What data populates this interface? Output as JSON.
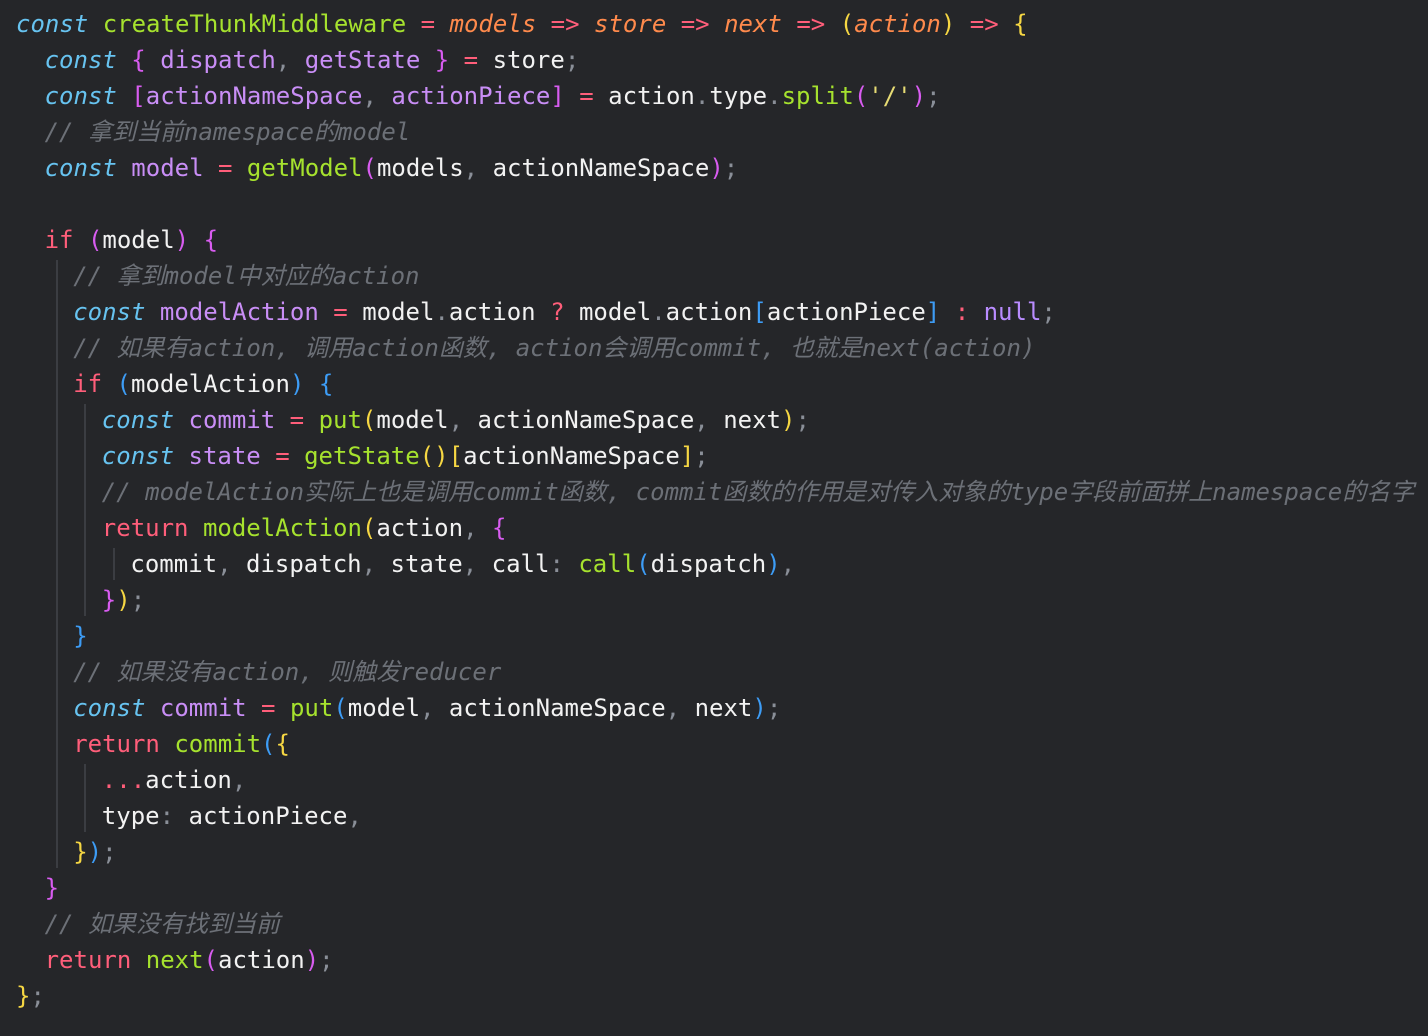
{
  "editor": {
    "language": "javascript",
    "lines": [
      {
        "indent": 0,
        "tokens": [
          [
            "kw",
            "const"
          ],
          [
            "text",
            " "
          ],
          [
            "fn",
            "createThunkMiddleware"
          ],
          [
            "text",
            " "
          ],
          [
            "op",
            "="
          ],
          [
            "text",
            " "
          ],
          [
            "param",
            "models"
          ],
          [
            "text",
            " "
          ],
          [
            "op",
            "=>"
          ],
          [
            "text",
            " "
          ],
          [
            "param",
            "store"
          ],
          [
            "text",
            " "
          ],
          [
            "op",
            "=>"
          ],
          [
            "text",
            " "
          ],
          [
            "param",
            "next"
          ],
          [
            "text",
            " "
          ],
          [
            "op",
            "=>"
          ],
          [
            "text",
            " "
          ],
          [
            "br1",
            "("
          ],
          [
            "param",
            "action"
          ],
          [
            "br1",
            ")"
          ],
          [
            "text",
            " "
          ],
          [
            "op",
            "=>"
          ],
          [
            "text",
            " "
          ],
          [
            "br1",
            "{"
          ]
        ]
      },
      {
        "indent": 1,
        "tokens": [
          [
            "kw",
            "const"
          ],
          [
            "text",
            " "
          ],
          [
            "br2",
            "{"
          ],
          [
            "text",
            " "
          ],
          [
            "var",
            "dispatch"
          ],
          [
            "punc",
            ","
          ],
          [
            "text",
            " "
          ],
          [
            "var",
            "getState"
          ],
          [
            "text",
            " "
          ],
          [
            "br2",
            "}"
          ],
          [
            "text",
            " "
          ],
          [
            "op",
            "="
          ],
          [
            "text",
            " "
          ],
          [
            "prop",
            "store"
          ],
          [
            "punc",
            ";"
          ]
        ]
      },
      {
        "indent": 1,
        "tokens": [
          [
            "kw",
            "const"
          ],
          [
            "text",
            " "
          ],
          [
            "br2",
            "["
          ],
          [
            "var",
            "actionNameSpace"
          ],
          [
            "punc",
            ","
          ],
          [
            "text",
            " "
          ],
          [
            "var",
            "actionPiece"
          ],
          [
            "br2",
            "]"
          ],
          [
            "text",
            " "
          ],
          [
            "op",
            "="
          ],
          [
            "text",
            " "
          ],
          [
            "prop",
            "action"
          ],
          [
            "punc",
            "."
          ],
          [
            "prop",
            "type"
          ],
          [
            "punc",
            "."
          ],
          [
            "fn",
            "split"
          ],
          [
            "br2",
            "("
          ],
          [
            "str",
            "'/'"
          ],
          [
            "br2",
            ")"
          ],
          [
            "punc",
            ";"
          ]
        ]
      },
      {
        "indent": 1,
        "tokens": [
          [
            "comment",
            "// 拿到当前namespace的model"
          ]
        ]
      },
      {
        "indent": 1,
        "tokens": [
          [
            "kw",
            "const"
          ],
          [
            "text",
            " "
          ],
          [
            "var",
            "model"
          ],
          [
            "text",
            " "
          ],
          [
            "op",
            "="
          ],
          [
            "text",
            " "
          ],
          [
            "fn",
            "getModel"
          ],
          [
            "br2",
            "("
          ],
          [
            "prop",
            "models"
          ],
          [
            "punc",
            ","
          ],
          [
            "text",
            " "
          ],
          [
            "prop",
            "actionNameSpace"
          ],
          [
            "br2",
            ")"
          ],
          [
            "punc",
            ";"
          ]
        ]
      },
      {
        "indent": 1,
        "tokens": []
      },
      {
        "indent": 1,
        "tokens": [
          [
            "ctrl",
            "if"
          ],
          [
            "text",
            " "
          ],
          [
            "br2",
            "("
          ],
          [
            "prop",
            "model"
          ],
          [
            "br2",
            ")"
          ],
          [
            "text",
            " "
          ],
          [
            "br2",
            "{"
          ]
        ]
      },
      {
        "indent": 2,
        "tokens": [
          [
            "comment",
            "// 拿到model中对应的action"
          ]
        ]
      },
      {
        "indent": 2,
        "tokens": [
          [
            "kw",
            "const"
          ],
          [
            "text",
            " "
          ],
          [
            "var",
            "modelAction"
          ],
          [
            "text",
            " "
          ],
          [
            "op",
            "="
          ],
          [
            "text",
            " "
          ],
          [
            "prop",
            "model"
          ],
          [
            "punc",
            "."
          ],
          [
            "prop",
            "action"
          ],
          [
            "text",
            " "
          ],
          [
            "op",
            "?"
          ],
          [
            "text",
            " "
          ],
          [
            "prop",
            "model"
          ],
          [
            "punc",
            "."
          ],
          [
            "prop",
            "action"
          ],
          [
            "br3",
            "["
          ],
          [
            "prop",
            "actionPiece"
          ],
          [
            "br3",
            "]"
          ],
          [
            "text",
            " "
          ],
          [
            "op",
            ":"
          ],
          [
            "text",
            " "
          ],
          [
            "null",
            "null"
          ],
          [
            "punc",
            ";"
          ]
        ]
      },
      {
        "indent": 2,
        "tokens": [
          [
            "comment",
            "// 如果有action, 调用action函数, action会调用commit, 也就是next(action)"
          ]
        ]
      },
      {
        "indent": 2,
        "tokens": [
          [
            "ctrl",
            "if"
          ],
          [
            "text",
            " "
          ],
          [
            "br3",
            "("
          ],
          [
            "prop",
            "modelAction"
          ],
          [
            "br3",
            ")"
          ],
          [
            "text",
            " "
          ],
          [
            "br3",
            "{"
          ]
        ]
      },
      {
        "indent": 3,
        "tokens": [
          [
            "kw",
            "const"
          ],
          [
            "text",
            " "
          ],
          [
            "var",
            "commit"
          ],
          [
            "text",
            " "
          ],
          [
            "op",
            "="
          ],
          [
            "text",
            " "
          ],
          [
            "fn",
            "put"
          ],
          [
            "br1",
            "("
          ],
          [
            "prop",
            "model"
          ],
          [
            "punc",
            ","
          ],
          [
            "text",
            " "
          ],
          [
            "prop",
            "actionNameSpace"
          ],
          [
            "punc",
            ","
          ],
          [
            "text",
            " "
          ],
          [
            "prop",
            "next"
          ],
          [
            "br1",
            ")"
          ],
          [
            "punc",
            ";"
          ]
        ]
      },
      {
        "indent": 3,
        "tokens": [
          [
            "kw",
            "const"
          ],
          [
            "text",
            " "
          ],
          [
            "var",
            "state"
          ],
          [
            "text",
            " "
          ],
          [
            "op",
            "="
          ],
          [
            "text",
            " "
          ],
          [
            "fn",
            "getState"
          ],
          [
            "br1",
            "()"
          ],
          [
            "br1",
            "["
          ],
          [
            "prop",
            "actionNameSpace"
          ],
          [
            "br1",
            "]"
          ],
          [
            "punc",
            ";"
          ]
        ]
      },
      {
        "indent": 3,
        "tokens": [
          [
            "comment",
            "// modelAction实际上也是调用commit函数, commit函数的作用是对传入对象的type字段前面拼上namespace的名字"
          ]
        ]
      },
      {
        "indent": 3,
        "tokens": [
          [
            "ctrl",
            "return"
          ],
          [
            "text",
            " "
          ],
          [
            "fn",
            "modelAction"
          ],
          [
            "br1",
            "("
          ],
          [
            "prop",
            "action"
          ],
          [
            "punc",
            ","
          ],
          [
            "text",
            " "
          ],
          [
            "br2",
            "{"
          ]
        ]
      },
      {
        "indent": 4,
        "tokens": [
          [
            "prop",
            "commit"
          ],
          [
            "punc",
            ","
          ],
          [
            "text",
            " "
          ],
          [
            "prop",
            "dispatch"
          ],
          [
            "punc",
            ","
          ],
          [
            "text",
            " "
          ],
          [
            "prop",
            "state"
          ],
          [
            "punc",
            ","
          ],
          [
            "text",
            " "
          ],
          [
            "prop",
            "call"
          ],
          [
            "punc",
            ":"
          ],
          [
            "text",
            " "
          ],
          [
            "fn",
            "call"
          ],
          [
            "br3",
            "("
          ],
          [
            "prop",
            "dispatch"
          ],
          [
            "br3",
            ")"
          ],
          [
            "punc",
            ","
          ]
        ]
      },
      {
        "indent": 3,
        "tokens": [
          [
            "br2",
            "}"
          ],
          [
            "br1",
            ")"
          ],
          [
            "punc",
            ";"
          ]
        ]
      },
      {
        "indent": 2,
        "tokens": [
          [
            "br3",
            "}"
          ]
        ]
      },
      {
        "indent": 2,
        "tokens": [
          [
            "comment",
            "// 如果没有action, 则触发reducer"
          ]
        ]
      },
      {
        "indent": 2,
        "tokens": [
          [
            "kw",
            "const"
          ],
          [
            "text",
            " "
          ],
          [
            "var",
            "commit"
          ],
          [
            "text",
            " "
          ],
          [
            "op",
            "="
          ],
          [
            "text",
            " "
          ],
          [
            "fn",
            "put"
          ],
          [
            "br3",
            "("
          ],
          [
            "prop",
            "model"
          ],
          [
            "punc",
            ","
          ],
          [
            "text",
            " "
          ],
          [
            "prop",
            "actionNameSpace"
          ],
          [
            "punc",
            ","
          ],
          [
            "text",
            " "
          ],
          [
            "prop",
            "next"
          ],
          [
            "br3",
            ")"
          ],
          [
            "punc",
            ";"
          ]
        ]
      },
      {
        "indent": 2,
        "tokens": [
          [
            "ctrl",
            "return"
          ],
          [
            "text",
            " "
          ],
          [
            "fn",
            "commit"
          ],
          [
            "br3",
            "("
          ],
          [
            "br1",
            "{"
          ]
        ]
      },
      {
        "indent": 3,
        "tokens": [
          [
            "op",
            "..."
          ],
          [
            "prop",
            "action"
          ],
          [
            "punc",
            ","
          ]
        ]
      },
      {
        "indent": 3,
        "tokens": [
          [
            "prop",
            "type"
          ],
          [
            "punc",
            ":"
          ],
          [
            "text",
            " "
          ],
          [
            "prop",
            "actionPiece"
          ],
          [
            "punc",
            ","
          ]
        ]
      },
      {
        "indent": 2,
        "tokens": [
          [
            "br1",
            "}"
          ],
          [
            "br3",
            ")"
          ],
          [
            "punc",
            ";"
          ]
        ]
      },
      {
        "indent": 1,
        "tokens": [
          [
            "br2",
            "}"
          ]
        ]
      },
      {
        "indent": 1,
        "tokens": [
          [
            "comment",
            "// 如果没有找到当前"
          ]
        ]
      },
      {
        "indent": 1,
        "tokens": [
          [
            "ctrl",
            "return"
          ],
          [
            "text",
            " "
          ],
          [
            "fn",
            "next"
          ],
          [
            "br2",
            "("
          ],
          [
            "prop",
            "action"
          ],
          [
            "br2",
            ")"
          ],
          [
            "punc",
            ";"
          ]
        ]
      },
      {
        "indent": 0,
        "tokens": [
          [
            "br1",
            "}"
          ],
          [
            "punc",
            ";"
          ]
        ]
      }
    ]
  }
}
